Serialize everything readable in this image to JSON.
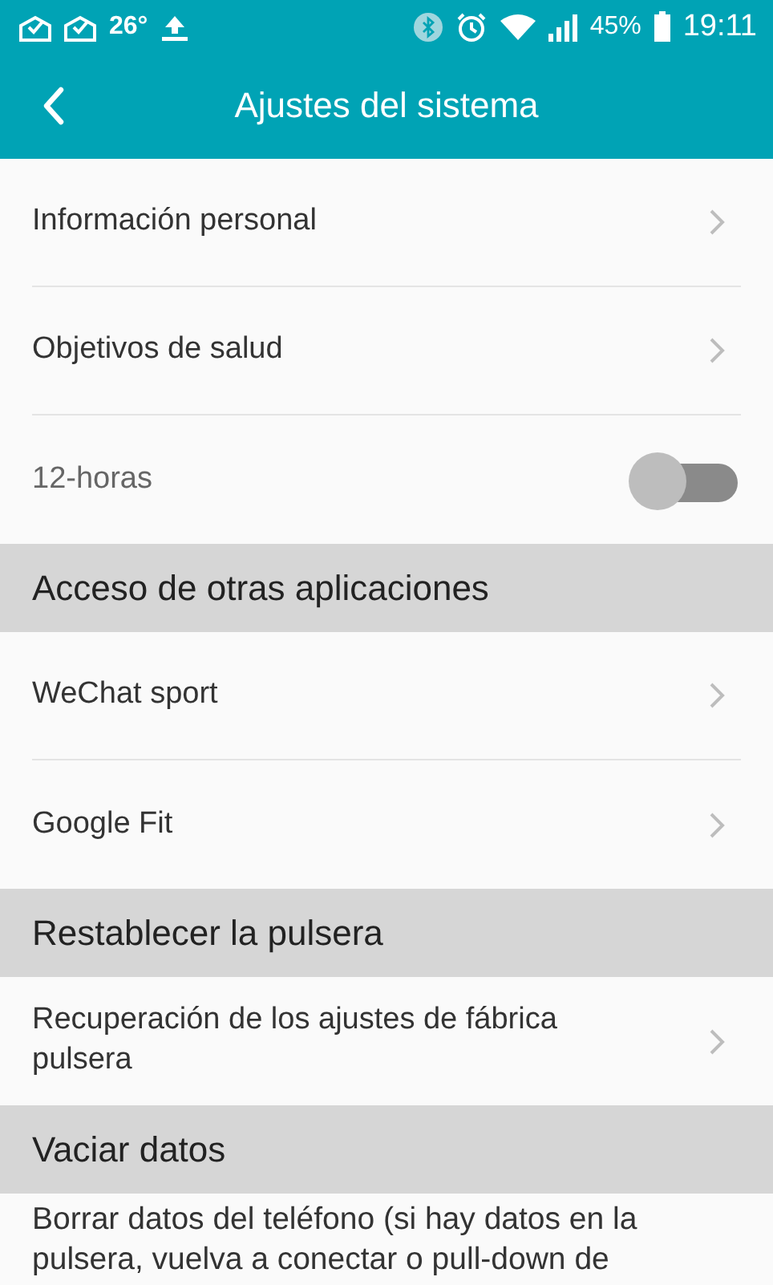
{
  "status_bar": {
    "temperature": "26°",
    "battery": "45%",
    "time": "19:11"
  },
  "header": {
    "title": "Ajustes del sistema"
  },
  "groups": [
    {
      "items": [
        {
          "kind": "link",
          "label": "Información personal"
        },
        {
          "kind": "link",
          "label": "Objetivos de salud"
        },
        {
          "kind": "toggle",
          "label": "12-horas",
          "on": false
        }
      ]
    },
    {
      "header": "Acceso de otras aplicaciones",
      "items": [
        {
          "kind": "link",
          "label": "WeChat sport"
        },
        {
          "kind": "link",
          "label": "Google Fit"
        }
      ]
    },
    {
      "header": "Restablecer la pulsera",
      "items": [
        {
          "kind": "link",
          "label": "Recuperación de los ajustes de fábrica pulsera"
        }
      ]
    },
    {
      "header": "Vaciar datos",
      "items": [
        {
          "kind": "text",
          "label": "Borrar datos del teléfono (si hay datos en la pulsera, vuelva a conectar o pull-down de"
        }
      ]
    }
  ]
}
